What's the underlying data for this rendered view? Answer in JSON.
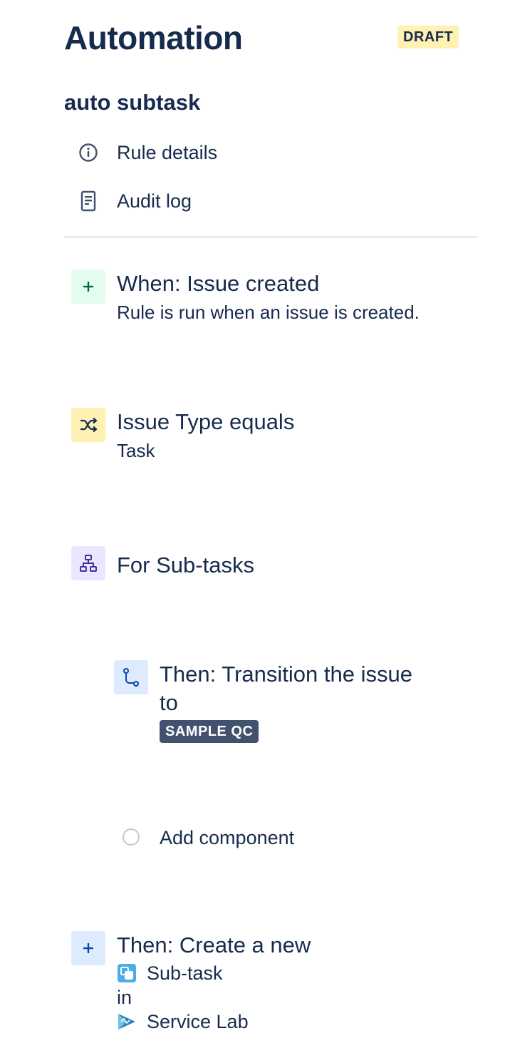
{
  "header": {
    "title": "Automation",
    "status_badge": "DRAFT"
  },
  "rule": {
    "name": "auto subtask",
    "nav": [
      {
        "label": "Rule details",
        "icon": "info-icon"
      },
      {
        "label": "Audit log",
        "icon": "document-icon"
      }
    ]
  },
  "steps": {
    "trigger": {
      "title": "When: Issue created",
      "subtitle": "Rule is run when an issue is created.",
      "icon": "plus-icon",
      "color": "#E3FCEF"
    },
    "condition": {
      "title": "Issue Type equals",
      "subtitle": "Task",
      "icon": "shuffle-icon",
      "color": "#FFF0B3"
    },
    "branch": {
      "title": "For Sub-tasks",
      "icon": "hierarchy-icon",
      "color": "#EAE6FF"
    },
    "transition": {
      "title_line1": "Then: Transition the issue",
      "title_line2": "to",
      "status": "SAMPLE QC",
      "icon": "transition-icon",
      "color": "#DEEBFF"
    },
    "add_component": {
      "label": "Add component"
    },
    "create": {
      "title": "Then: Create a new",
      "issue_type": "Sub-task",
      "connector": "in",
      "project": "Service Lab",
      "icon": "plus-icon",
      "color": "#DEEBFF"
    }
  }
}
